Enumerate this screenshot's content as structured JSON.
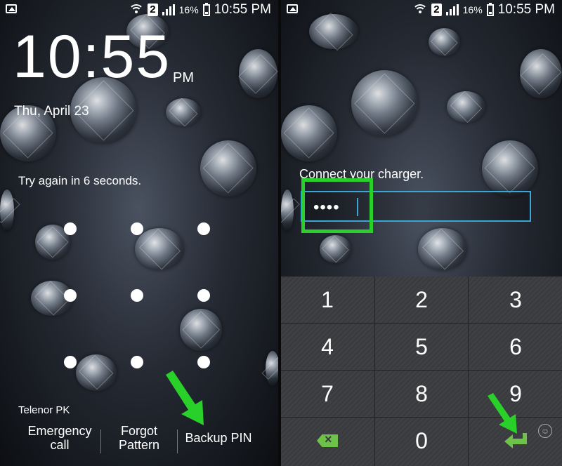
{
  "left": {
    "status": {
      "sim": "2",
      "battery": "16%",
      "time": "10:55 PM"
    },
    "clock": {
      "time": "10:55",
      "ampm": "PM",
      "date": "Thu, April 23"
    },
    "message": "Try again in 6 seconds.",
    "carrier": "Telenor PK",
    "buttons": {
      "emergency": "Emergency call",
      "forgot": "Forgot Pattern",
      "backup": "Backup PIN"
    }
  },
  "right": {
    "status": {
      "sim": "2",
      "battery": "16%",
      "time": "10:55 PM"
    },
    "message": "Connect your charger.",
    "pin_value": "••••",
    "keys": [
      "1",
      "2",
      "3",
      "4",
      "5",
      "6",
      "7",
      "8",
      "9",
      "0"
    ]
  },
  "colors": {
    "accent_green": "#2ad02a",
    "field_border": "#3aa6d6",
    "keypad_bg": "#3a3b3e"
  },
  "icons": [
    "gallery-icon",
    "wifi-icon",
    "signal-icon",
    "battery-icon",
    "backspace-icon",
    "enter-icon",
    "emoji-icon",
    "arrow-pointer-icon"
  ]
}
